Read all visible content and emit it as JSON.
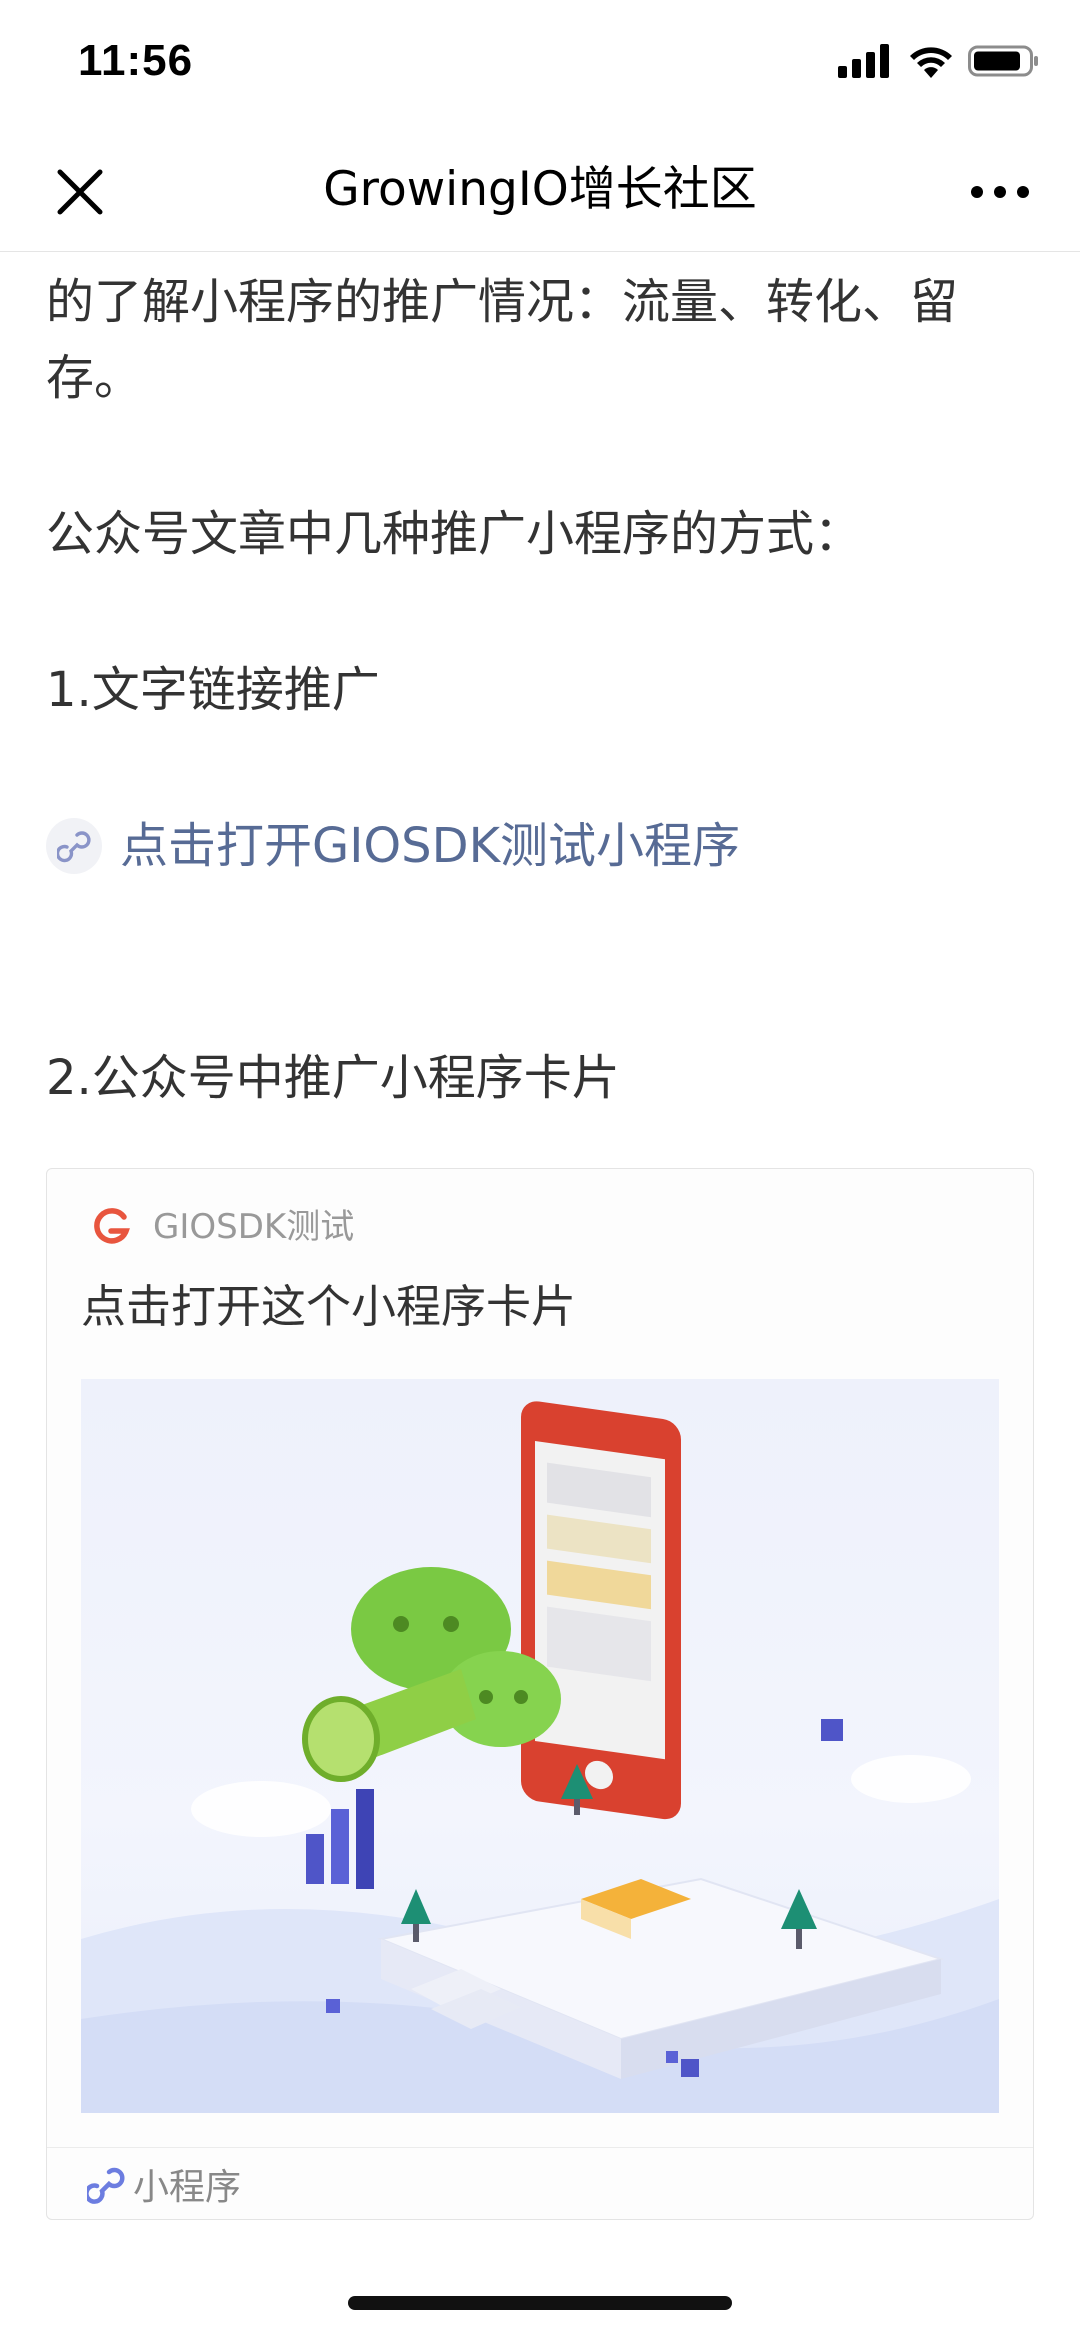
{
  "status_bar": {
    "time": "11:56"
  },
  "nav": {
    "title": "GrowingIO增长社区"
  },
  "article": {
    "para1_line1": "的了解小程序的推广情况：流量、转化、留",
    "para1_line2": "存。",
    "para2": "公众号文章中几种推广小程序的方式：",
    "heading1": "1.文字链接推广",
    "link_text": "点击打开GIOSDK测试小程序",
    "heading2": "2.公众号中推广小程序卡片"
  },
  "card": {
    "app_name": "GIOSDK测试",
    "title": "点击打开这个小程序卡片",
    "footer_label": "小程序"
  },
  "colors": {
    "link": "#576b95",
    "text": "#333333",
    "logo_red": "#e8553e",
    "miniprogram_icon": "#6c7de0"
  },
  "icons": {
    "close": "close-icon",
    "more": "more-icon",
    "link": "miniprogram-link-icon",
    "signal": "signal-icon",
    "wifi": "wifi-icon",
    "battery": "battery-icon"
  }
}
